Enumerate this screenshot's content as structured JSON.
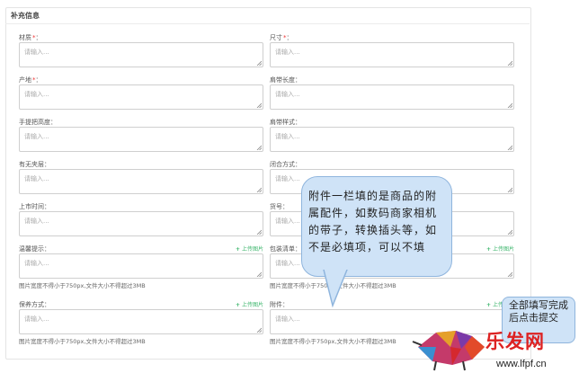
{
  "section": {
    "title": "补充信息"
  },
  "fields": {
    "material": {
      "label": "材质",
      "required": "*",
      "colon": "：",
      "placeholder": "请输入..."
    },
    "size": {
      "label": "尺寸",
      "required": "*",
      "colon": "：",
      "placeholder": "请输入..."
    },
    "origin": {
      "label": "产地",
      "required": "*",
      "colon": "：",
      "placeholder": "请输入..."
    },
    "strap_length": {
      "label": "肩带长度",
      "colon": "：",
      "placeholder": "请输入..."
    },
    "handle_height": {
      "label": "手提把高度",
      "colon": "：",
      "placeholder": "请输入..."
    },
    "strap_style": {
      "label": "肩带样式",
      "colon": "：",
      "placeholder": "请输入..."
    },
    "interlayer": {
      "label": "有无夹层",
      "colon": "：",
      "placeholder": "请输入..."
    },
    "closure": {
      "label": "闭合方式",
      "colon": "：",
      "placeholder": "请输入..."
    },
    "launch_time": {
      "label": "上市时间",
      "colon": "：",
      "placeholder": "请输入..."
    },
    "model": {
      "label": "货号",
      "colon": "：",
      "placeholder": "请输入..."
    },
    "warm_tips": {
      "label": "温馨提示",
      "colon": "：",
      "placeholder": "请输入...",
      "upload": "上传图片",
      "hint": "图片宽度不得小于750px,文件大小不得超过3MB"
    },
    "package_list": {
      "label": "包装清单",
      "colon": "：",
      "placeholder": "请输入...",
      "upload": "上传图片",
      "hint": "图片宽度不得小于750px,文件大小不得超过3MB"
    },
    "maintenance": {
      "label": "保养方式",
      "colon": "：",
      "placeholder": "请输入...",
      "upload": "上传图片",
      "hint": "图片宽度不得小于750px,文件大小不得超过3MB"
    },
    "accessories": {
      "label": "附件",
      "colon": "：",
      "placeholder": "请输入...",
      "upload": "上传图片",
      "hint": "图片宽度不得小于750px,文件大小不得超过3MB"
    }
  },
  "annotation": {
    "bubble_text": "附件一栏填的是商品的附属配件，如数码商家相机的带子，转换插头等，如不是必填项，可以不填",
    "note_text": "全部填写完成后点击提交"
  },
  "watermark": {
    "text": "乐发网",
    "url": "www.lfpf.cn"
  },
  "colors": {
    "upload_green": "#3bb56b",
    "required_red": "#ee3333",
    "bubble_fill": "#cfe3f7",
    "bubble_border": "#8fb5dd"
  }
}
